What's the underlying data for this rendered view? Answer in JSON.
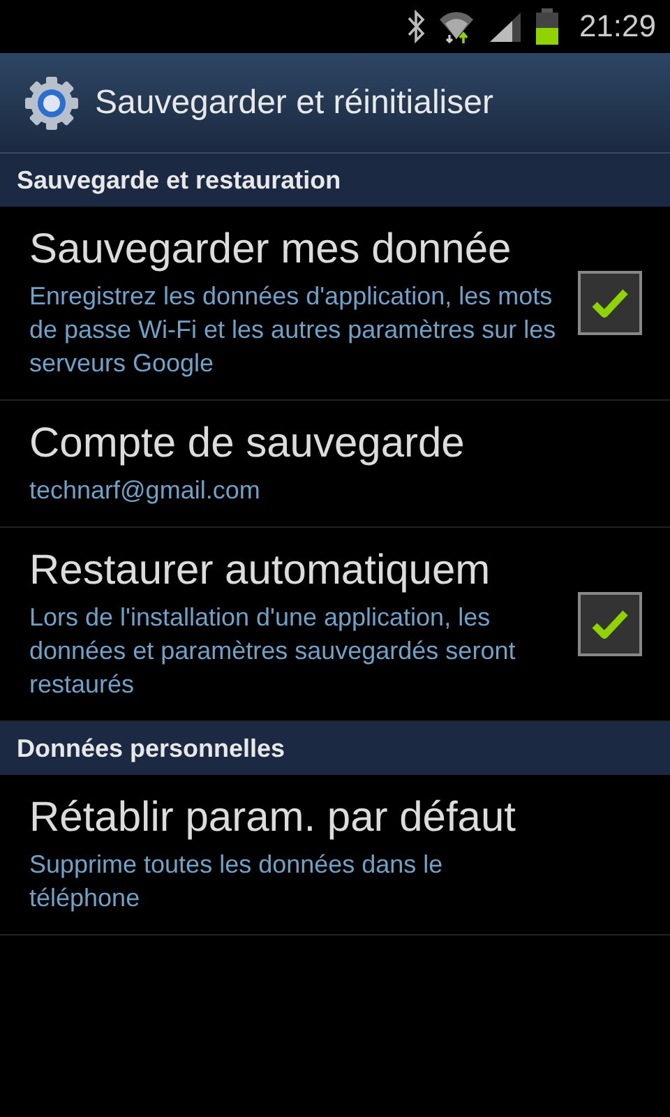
{
  "status_bar": {
    "time": "21:29"
  },
  "title_bar": {
    "title": "Sauvegarder et réinitialiser"
  },
  "sections": [
    {
      "header": "Sauvegarde et restauration",
      "items": [
        {
          "kind": "checkbox",
          "title": "Sauvegarder mes donnée",
          "summary": "Enregistrez les données d'application, les mots de passe Wi-Fi et les autres paramètres sur les serveurs Google",
          "checked": true
        },
        {
          "kind": "plain",
          "title": "Compte de sauvegarde",
          "summary": "technarf@gmail.com"
        },
        {
          "kind": "checkbox",
          "title": "Restaurer automatiquem",
          "summary": "Lors de l'installation d'une application, les données et paramètres sauvegardés seront restaurés",
          "checked": true
        }
      ]
    },
    {
      "header": "Données personnelles",
      "items": [
        {
          "kind": "plain",
          "title": "Rétablir param. par défaut",
          "summary": "Supprime toutes les données dans le téléphone"
        }
      ]
    }
  ]
}
